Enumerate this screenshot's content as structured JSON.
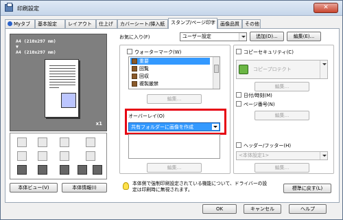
{
  "window": {
    "title": "印刷設定",
    "close_label": "✕"
  },
  "tabs": [
    "Myタブ",
    "基本設定",
    "レイアウト",
    "仕上げ",
    "カバーシート/挿入紙",
    "スタンプ/ページ印字",
    "画像品質",
    "その他"
  ],
  "active_tab": "スタンプ/ページ印字",
  "preview": {
    "line1": "A4 (210x297 mm)",
    "arrow": "▼",
    "line2": "A4 (210x297 mm)",
    "copies": "x1"
  },
  "left_buttons": {
    "printer_view": "本体ビュー(V)",
    "printer_info": "本体情報(I)"
  },
  "favorites": {
    "label": "お気に入り(F)",
    "value": "ユーザー設定",
    "add": "追加(D)...",
    "edit": "編集(E)..."
  },
  "watermark": {
    "label": "ウォーターマーク(W)",
    "items": [
      "重要",
      "回覧",
      "回収",
      "複製厳禁"
    ],
    "selected_index": 0,
    "edit": "編集..."
  },
  "overlay": {
    "label": "オーバーレイ(O)",
    "value": "共有フォルダーに画像を作成",
    "edit": "編集..."
  },
  "copy_security": {
    "label": "コピーセキュリティ(C)",
    "value": "コピープロテクト",
    "edit": "編集..."
  },
  "date_time": {
    "label": "日付/時刻(M)"
  },
  "page_number": {
    "label": "ページ番号(N)",
    "edit": "編集..."
  },
  "header_footer": {
    "label": "ヘッダー/フッター(H)",
    "value": "<本体設定1>",
    "edit": "編集..."
  },
  "info_text": "本体側で強制印刷設定されている機能について、ドライバーの設定は印刷時に無視されます。",
  "restore_defaults": "標準に戻す(L)",
  "footer": {
    "ok": "OK",
    "cancel": "キャンセル",
    "help": "ヘルプ"
  },
  "colors": {
    "accent": "#3399ff",
    "highlight": "#e60012",
    "preview_bg": "#7f7f7f"
  }
}
